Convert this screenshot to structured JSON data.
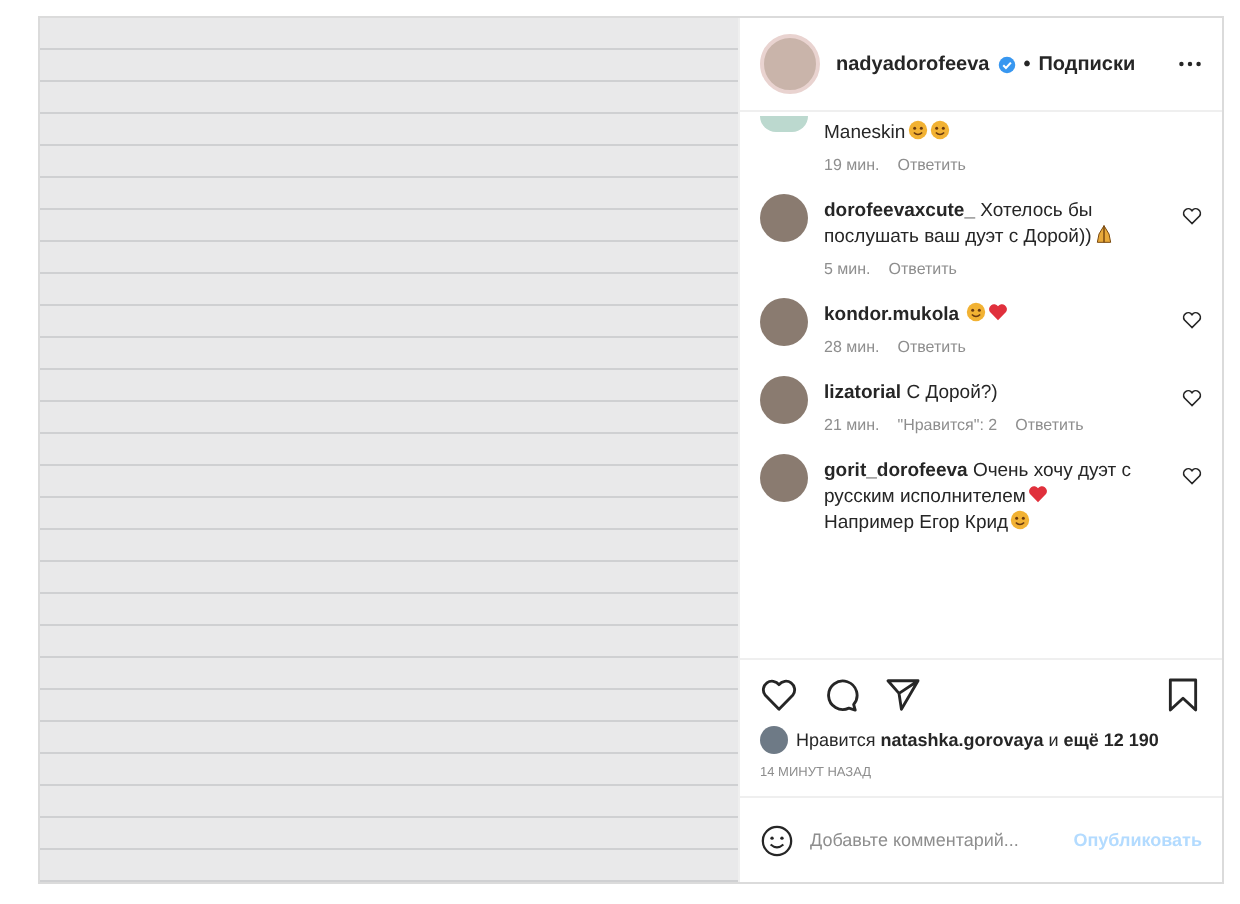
{
  "post": {
    "author": {
      "username": "nadyadorofeeva",
      "verified": true,
      "separator": "•",
      "follow_label": "Подписки"
    },
    "comments": [
      {
        "text": "Maneskin",
        "emojis": [
          {
            "kind": "face"
          },
          {
            "kind": "face"
          }
        ],
        "time": "19 мин.",
        "reply": "Ответить",
        "cut": true
      },
      {
        "username": "dorofeevaxcute_",
        "text": "Хотелось бы послушать ваш дуэт с Дорой))",
        "emojis": [
          {
            "kind": "praying"
          }
        ],
        "time": "5 мин.",
        "reply": "Ответить",
        "cut": false
      },
      {
        "username": "kondor.mukola",
        "emojis": [
          {
            "kind": "face"
          },
          {
            "kind": "heart"
          }
        ],
        "time": "28 мин.",
        "reply": "Ответить",
        "cut": false
      },
      {
        "username": "lizatorial",
        "text": "С Дорой?)",
        "time": "21 мин.",
        "likes": "\"Нравится\": 2",
        "reply": "Ответить",
        "cut": false
      },
      {
        "username": "gorit_dorofeeva",
        "text": "Очень хочу дуэт с русским исполнителем",
        "emojis": [
          {
            "kind": "heart"
          }
        ],
        "text2": "Например Егор Крид",
        "emojis2": [
          {
            "kind": "face"
          }
        ],
        "cut": false
      }
    ],
    "likes_text": "Нравится **natashka.gorovaya** и **ещё 12 190**",
    "posted": "14 МИНУТ НАЗАД",
    "comment_field": {
      "placeholder": "Добавьте комментарий...",
      "publish_label": "Опубликовать"
    }
  }
}
